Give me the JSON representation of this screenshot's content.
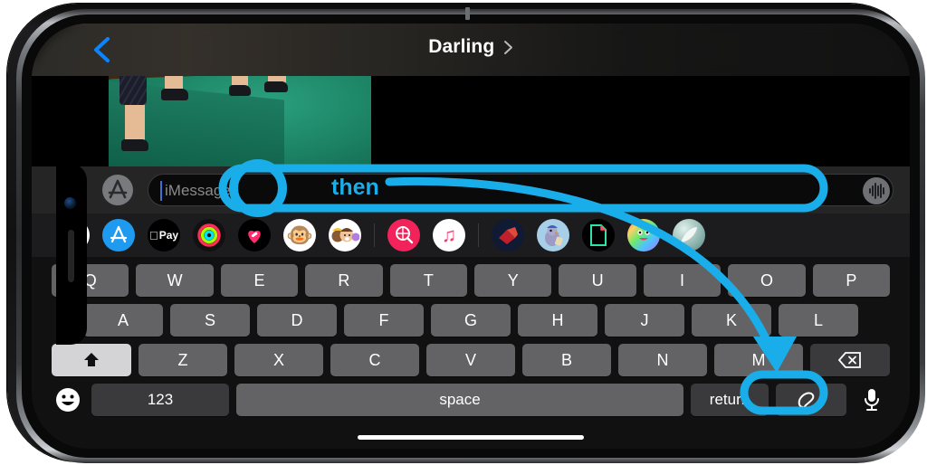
{
  "device": {
    "name": "iPhone",
    "orientation": "landscape",
    "frame_color": "#1d1d1f"
  },
  "nav": {
    "back_icon": "chevron-left-icon",
    "title": "Darling",
    "title_chevron_icon": "chevron-right-icon",
    "tint_color": "#0a84ff"
  },
  "conversation": {
    "attachment_type": "photo-thumbnail",
    "attachment_description": "green gymnastics mat with legs"
  },
  "composer": {
    "camera_icon": "camera-icon",
    "appstore_icon": "app-store-icon",
    "placeholder": "iMessage",
    "value": "",
    "audio_icon": "audio-waveform-icon",
    "caret_color": "#3f6fd8"
  },
  "app_drawer": {
    "items": [
      {
        "name": "photos-app-icon",
        "glyph": "✿",
        "bg": "#ffffff",
        "fg": "#e8447a"
      },
      {
        "name": "app-store-app-icon",
        "glyph": "🅐",
        "bg": "#1e9bf0",
        "fg": "#ffffff"
      },
      {
        "name": "apple-pay-icon",
        "glyph": "Pay",
        "bg": "#000000",
        "fg": "#ffffff"
      },
      {
        "name": "activity-rings-icon",
        "glyph": "◎",
        "bg": "#111111",
        "fg": "#35e84a"
      },
      {
        "name": "health-icon",
        "glyph": "♥",
        "bg": "#000000",
        "fg": "#ff2d6f"
      },
      {
        "name": "animoji-monkey-icon",
        "glyph": "😵",
        "bg": "#ffffff",
        "fg": "#9a6b3f"
      },
      {
        "name": "memoji-stickers-icon",
        "glyph": "👪",
        "bg": "#ffffff",
        "fg": "#c98a5a"
      },
      {
        "name": "separator",
        "glyph": "",
        "bg": "",
        "fg": ""
      },
      {
        "name": "image-search-icon",
        "glyph": "🔍",
        "bg": "#f2235b",
        "fg": "#ffffff"
      },
      {
        "name": "music-app-icon",
        "glyph": "♫",
        "bg": "#ffffff",
        "fg": "#e8447a"
      },
      {
        "name": "separator",
        "glyph": "",
        "bg": "",
        "fg": ""
      },
      {
        "name": "red-shape-sticker-icon",
        "glyph": "◆",
        "bg": "#101a33",
        "fg": "#d8252f"
      },
      {
        "name": "bird-sticker-icon",
        "glyph": "🐦",
        "bg": "#a8cfe8",
        "fg": "#6f6f9a"
      },
      {
        "name": "document-sticker-icon",
        "glyph": "📄",
        "bg": "#000000",
        "fg": "#36e0b0"
      },
      {
        "name": "rainbow-face-icon",
        "glyph": "😃",
        "bg": "#ffd84d",
        "fg": "#000000"
      },
      {
        "name": "teal-feather-icon",
        "glyph": "✐",
        "bg": "#7fa8a2",
        "fg": "#ffffff"
      }
    ]
  },
  "keyboard": {
    "row1": [
      "Q",
      "W",
      "E",
      "R",
      "T",
      "Y",
      "U",
      "I",
      "O",
      "P"
    ],
    "row2": [
      "A",
      "S",
      "D",
      "F",
      "G",
      "H",
      "J",
      "K",
      "L"
    ],
    "row3": [
      "Z",
      "X",
      "C",
      "V",
      "B",
      "N",
      "M"
    ],
    "shift_icon": "shift-arrow-icon",
    "shift_active": true,
    "backspace_icon": "backspace-icon",
    "emoji_icon": "emoji-smiley-icon",
    "numbers_label": "123",
    "space_label": "space",
    "return_label": "return",
    "scribble_icon": "scribble-handwriting-icon",
    "mic_icon": "microphone-icon"
  },
  "annotation": {
    "color": "#19AEEA",
    "label": "then",
    "circle_target": "text-caret-in-imessage-field",
    "arrow_target": "scribble-handwriting-key"
  }
}
